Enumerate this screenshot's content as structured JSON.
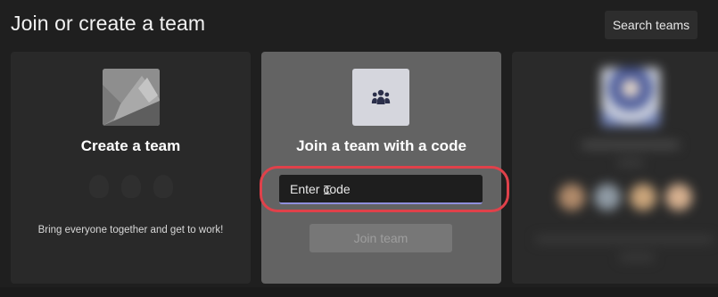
{
  "header": {
    "title": "Join or create a team",
    "search_button": "Search teams"
  },
  "cards": {
    "create": {
      "title": "Create a team",
      "description": "Bring everyone together and get to work!",
      "icon": "team-thumbnail-icon"
    },
    "join": {
      "title": "Join a team with a code",
      "input_placeholder": "Enter code",
      "input_value": "",
      "button_label": "Join team",
      "icon": "people-group-icon"
    },
    "blurred_team": {
      "state": "blurred"
    }
  },
  "colors": {
    "background": "#1f1f1f",
    "create_card": "#292929",
    "join_card": "#636363",
    "input_underline": "#8f8fdc",
    "highlight_ring": "#e0414a"
  }
}
